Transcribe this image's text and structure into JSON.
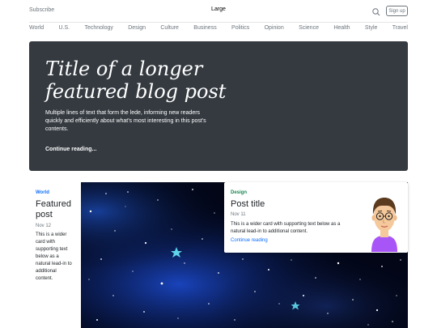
{
  "header": {
    "subscribe": "Subscribe",
    "logo": "Large",
    "signup": "Sign up",
    "search_icon": "search-icon"
  },
  "nav": [
    "World",
    "U.S.",
    "Technology",
    "Design",
    "Culture",
    "Business",
    "Politics",
    "Opinion",
    "Science",
    "Health",
    "Style",
    "Travel"
  ],
  "featured": {
    "title": "Title of a longer featured blog post",
    "lede": "Multiple lines of text that form the lede, informing new readers quickly and efficiently about what's most interesting in this post's contents.",
    "cta": "Continue reading..."
  },
  "card_left": {
    "category": "World",
    "title": "Featured post",
    "date": "Nov 12",
    "text": "This is a wider card with supporting text below as a natural lead-in to additional content."
  },
  "card_right": {
    "category": "Design",
    "title": "Post title",
    "date": "Nov 11",
    "text": "This is a wider card with supporting text below as a natural lead-in to additional content.",
    "link": "Continue reading"
  },
  "colors": {
    "jumbotron_bg": "#343a40",
    "world_blue": "#0d6efd",
    "design_green": "#198754",
    "muted": "#6c757d"
  }
}
